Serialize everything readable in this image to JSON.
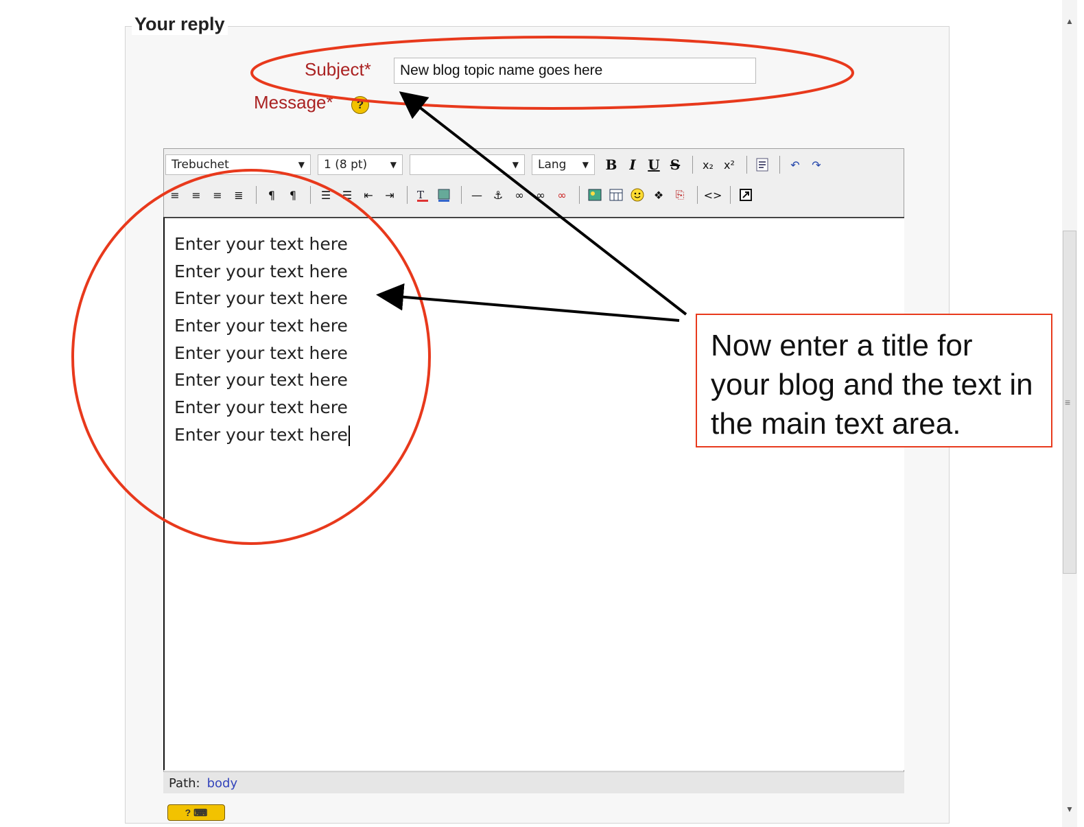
{
  "form": {
    "legend": "Your reply",
    "subject_label": "Subject*",
    "subject_value": "New blog topic name goes here",
    "message_label": "Message*",
    "help_glyph": "?"
  },
  "editor": {
    "font_select": "Trebuchet",
    "size_select": "1 (8 pt)",
    "format_select": "",
    "lang_select": "Lang",
    "toolbar_row1": [
      "bold-icon",
      "italic-icon",
      "underline-icon",
      "strikethrough-icon",
      "subscript-icon",
      "superscript-icon",
      "word-paste-icon",
      "undo-icon",
      "redo-icon"
    ],
    "toolbar_row2": [
      "align-left-icon",
      "align-center-icon",
      "align-right-icon",
      "justify-icon",
      "ltr-icon",
      "rtl-icon",
      "ordered-list-icon",
      "unordered-list-icon",
      "outdent-icon",
      "indent-icon",
      "text-color-icon",
      "bg-color-icon",
      "horizontal-rule-icon",
      "anchor-icon",
      "link-icon",
      "unlink-icon",
      "nolink-icon",
      "image-icon",
      "table-icon",
      "smiley-icon",
      "insert-char-icon",
      "search-replace-icon",
      "html-source-icon",
      "fullscreen-icon"
    ],
    "text_lines": [
      "Enter your text here",
      "Enter your text here",
      "Enter your text here",
      "Enter your text here",
      "Enter your text here",
      "Enter your text here",
      "Enter your text here",
      "Enter your text here"
    ],
    "path_label": "Path:",
    "path_value": "body"
  },
  "annotation": {
    "text": "Now enter a title for your blog and the text in the main text area.",
    "color": "#e8391c"
  },
  "colors": {
    "label_red": "#aa2222",
    "annotation_red": "#e8391c",
    "help_yellow": "#f2c200"
  }
}
